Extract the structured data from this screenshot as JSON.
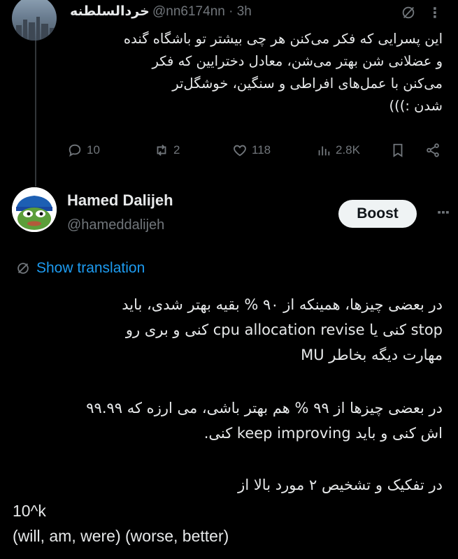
{
  "tweet1": {
    "display_name": "خردالسلطنه",
    "handle_time": "@nn6174nn · 3h",
    "lines": [
      "این پسرایی که فکر می‌کنن هر چی بیشتر تو باشگاه گنده",
      "و عضلانی شن بهتر می‌شن، معادل دخترایین که فکر",
      "می‌کنن با عمل‌های افراطی و سنگین، خوشگل‌تر",
      "شدن :)))"
    ],
    "actions": {
      "replies": "10",
      "reposts": "2",
      "likes": "118",
      "views": "2.8K"
    }
  },
  "tweet2": {
    "display_name": "Hamed Dalijeh",
    "handle": "@hameddalijeh",
    "boost_label": "Boost",
    "show_translation": "Show translation",
    "paragraph1": [
      "در بعضی چیزها، همینکه از ۹۰ % بقیه بهتر شدی، باید",
      "stop کنی یا cpu allocation revise کنی و بری رو",
      "مهارت دیگه بخاطر MU"
    ],
    "paragraph2": [
      "در بعضی چیزها از ۹۹ % هم بهتر باشی، می  ارزه که ۹۹.۹۹",
      "اش کنی و باید keep improving کنی."
    ],
    "paragraph3": "در تفکیک و تشخیص ۲ مورد بالا از",
    "formula": "10^k",
    "tuple_line": "(will, am, were) (worse, better)"
  },
  "colors": {
    "background": "#000000",
    "text": "#e7e9ea",
    "muted": "#71767b",
    "link": "#1d9bf0",
    "boost_bg": "#eff3f4"
  }
}
